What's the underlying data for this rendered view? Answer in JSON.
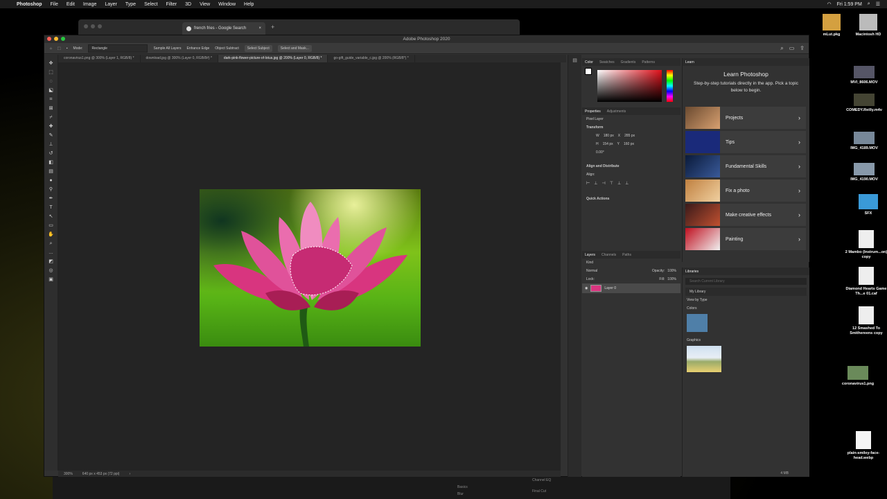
{
  "menubar": {
    "app_name": "Photoshop",
    "items": [
      "File",
      "Edit",
      "Image",
      "Layer",
      "Type",
      "Select",
      "Filter",
      "3D",
      "View",
      "Window",
      "Help"
    ],
    "clock": "Fri 1:59 PM"
  },
  "browser": {
    "tab_title": "french fries - Google Search"
  },
  "window": {
    "title": "Adobe Photoshop 2020"
  },
  "options": {
    "mode_label": "Mode:",
    "mode_value": "Rectangle",
    "sample_all_layers": "Sample All Layers",
    "enhance_edge": "Enhance Edge",
    "object_subtract": "Object Subtract",
    "select_subject": "Select Subject",
    "select_and_mask": "Select and Mask..."
  },
  "doc_tabs": [
    "coronavirus1.png @ 300% (Layer 1, RGB/8) *",
    "download.jpg @ 300% (Layer 0, RGB/8#) *",
    "dark-pink-flower-picture-of-lotus.jpg @ 200% (Layer 0, RGB/8) *",
    "go-gift_guide_variable_c.jpg @ 200% (RGB/8*) *"
  ],
  "status": {
    "zoom": "300%",
    "doc_size": "640 px x 453 px (72 ppi)"
  },
  "color_panel": {
    "tabs": [
      "Color",
      "Swatches",
      "Gradients",
      "Patterns"
    ]
  },
  "properties_panel": {
    "tabs": [
      "Properties",
      "Adjustments"
    ],
    "layer_type": "Pixel Layer",
    "transform": "Transform",
    "w": "180 px",
    "x": "285 px",
    "h": "154 px",
    "y": "160 px",
    "angle": "0.00°",
    "align": "Align and Distribute",
    "align_label": "Align:",
    "quick_actions": "Quick Actions"
  },
  "layers_panel": {
    "tabs": [
      "Layers",
      "Channels",
      "Paths"
    ],
    "kind": "Kind",
    "blend_mode": "Normal",
    "opacity_label": "Opacity:",
    "opacity": "100%",
    "lock_label": "Lock:",
    "fill_label": "Fill:",
    "fill": "100%",
    "layer_name": "Layer 0"
  },
  "learn": {
    "tab": "Learn",
    "title": "Learn Photoshop",
    "subtitle": "Step-by-step tutorials directly in the app. Pick a topic below to begin.",
    "items": [
      "Projects",
      "Tips",
      "Fundamental Skills",
      "Fix a photo",
      "Make creative effects",
      "Painting"
    ]
  },
  "libraries": {
    "title": "Libraries",
    "search_placeholder": "Search Current Library",
    "library": "My Library",
    "view_by": "View by Type",
    "colors": "Colors",
    "graphics": "Graphics",
    "size": "4 MB"
  },
  "desktop_icons": [
    "mLut.pkg",
    "Macintosh HD",
    "MVI_8606.MOV",
    "COMEDY.Reilly.m4v",
    "IMG_4189.MOV",
    "IMG_4190.MOV",
    "SFX",
    "2 Mambo (Instrum...on) copy",
    "Diamond Hearts Game Th...e 01.caf",
    "12 Smashed To Smithereens copy",
    "coronavirus1.png",
    "plain-smiley-face-head.webp"
  ],
  "dock": {
    "labels": [
      "Basics",
      "Blur",
      "Channel EQ",
      "Final Cut"
    ]
  }
}
